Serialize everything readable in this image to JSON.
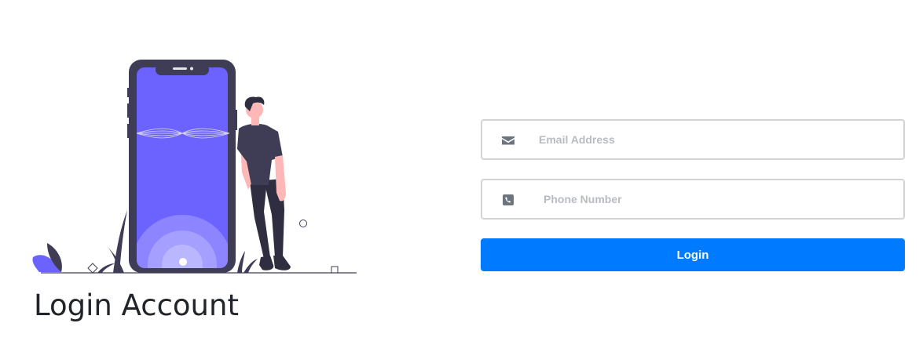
{
  "hero": {
    "title": "Login Account",
    "illustration": "person-leaning-on-phone-illustration"
  },
  "form": {
    "email": {
      "icon": "envelope-icon",
      "placeholder": "Email Address",
      "value": ""
    },
    "phone": {
      "icon": "phone-icon",
      "placeholder": "Phone Number",
      "value": ""
    },
    "submit_label": "Login"
  },
  "colors": {
    "accent": "#007bff",
    "illustration_purple": "#6c63ff",
    "illustration_dark": "#3f3d56",
    "text": "#212529",
    "placeholder": "#b8bcc1",
    "input_border": "#d3d3d3"
  }
}
